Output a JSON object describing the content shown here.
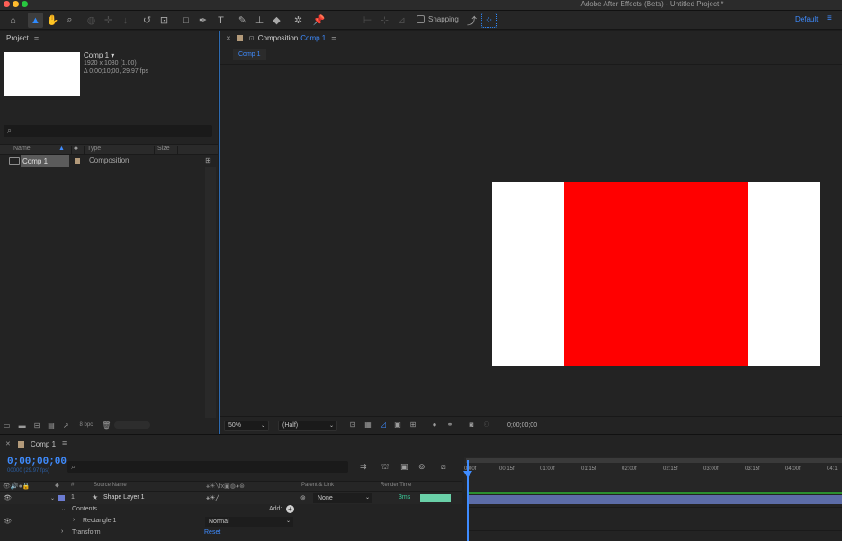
{
  "app": {
    "title": "Adobe After Effects (Beta) - Untitled Project *"
  },
  "toolbar": {
    "snapping_label": "Snapping",
    "workspace_label": "Default",
    "workspace_menu_icon": "hamburger-icon"
  },
  "project": {
    "panel_title": "Project",
    "comp_name": "Comp 1 ▾",
    "comp_dims": "1920 x 1080 (1.00)",
    "comp_duration": "Δ 0;00;10;00, 29.97 fps",
    "search_placeholder": "",
    "columns": {
      "name": "Name",
      "type": "Type",
      "size": "Size"
    },
    "items": [
      {
        "name": "Comp 1",
        "type": "Composition",
        "size": ""
      }
    ],
    "bpc": "8 bpc"
  },
  "composition": {
    "tab_label": "Composition",
    "tab_comp": "Comp 1",
    "breadcrumb": "Comp 1",
    "zoom": "50%",
    "resolution": "(Half)",
    "timecode": "0;00;00;00",
    "colors": {
      "canvas": "#ffffff",
      "shape_fill": "#ff0000"
    }
  },
  "timeline": {
    "tab_label": "Comp 1",
    "timecode": "0;00;00;00",
    "frame_info": "00000 (29.97 fps)",
    "columns": {
      "num": "#",
      "source": "Source Name",
      "parent": "Parent & Link",
      "render": "Render Time"
    },
    "layer": {
      "num": "1",
      "name": "Shape Layer 1",
      "parent": "None",
      "render_time": "3ms"
    },
    "contents_label": "Contents",
    "add_label": "Add:",
    "rectangle_label": "Rectangle 1",
    "blend_mode": "Normal",
    "transform_label": "Transform",
    "reset_label": "Reset",
    "ruler_ticks": [
      "0:00f",
      "00:15f",
      "01:00f",
      "01:15f",
      "02:00f",
      "02:15f",
      "03:00f",
      "03:15f",
      "04:00f",
      "04:1"
    ]
  }
}
